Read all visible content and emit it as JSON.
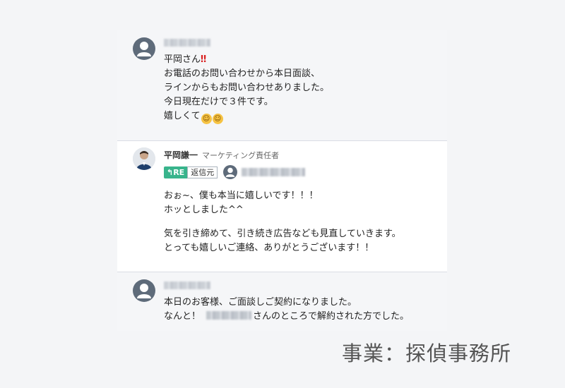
{
  "messages": [
    {
      "lines": [
        "平岡さん",
        "お電話のお問い合わせから本日面談、",
        "ラインからもお問い合わせありました。",
        "今日現在だけで３件です。",
        "嬉しくて"
      ],
      "emoji_after_first": "‼",
      "emoji_smile": "☺"
    },
    {
      "sender_name": "平岡謙一",
      "sender_title": "マーケティング責任者",
      "re_badge": "↰RE",
      "re_label": "返信元",
      "lines": [
        "おぉ~、僕も本当に嬉しいです！！！",
        "ホッとしました^^",
        "",
        "気を引き締めて、引き続き広告なども見直していきます。",
        "とっても嬉しいご連絡、ありがとうございます！！"
      ]
    },
    {
      "line1": "本日のお客様、ご面談しご契約になりました。",
      "line2_before": "なんと！",
      "line2_after": "さんのところで解約された方でした。"
    }
  ],
  "footer": "事業：探偵事務所"
}
